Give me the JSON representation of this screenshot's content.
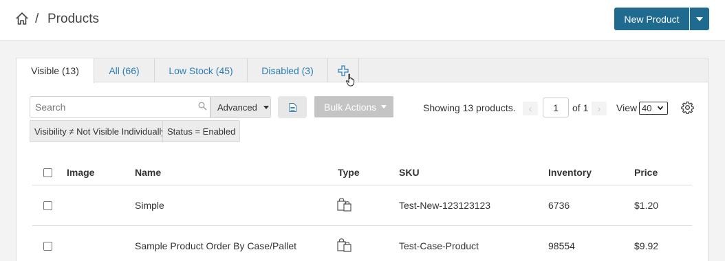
{
  "header": {
    "breadcrumb_sep": "/",
    "title": "Products",
    "new_button": "New Product",
    "home_icon": "home-icon",
    "caret_icon": "chevron-down-icon"
  },
  "tabs": [
    {
      "label": "Visible (13)",
      "active": true
    },
    {
      "label": "All (66)",
      "active": false
    },
    {
      "label": "Low Stock (45)",
      "active": false
    },
    {
      "label": "Disabled (3)",
      "active": false
    }
  ],
  "toolbar": {
    "search_placeholder": "Search",
    "search_value": "",
    "advanced_label": "Advanced",
    "bulk_actions_label": "Bulk Actions",
    "showing_text": "Showing 13 products.",
    "prev_symbol": "‹",
    "next_symbol": "›",
    "page_value": "1",
    "of_text": "of 1",
    "view_label": "View",
    "view_value": "40"
  },
  "filters": [
    "Visibility ≠ Not Visible Individually",
    "Status = Enabled"
  ],
  "table": {
    "columns": [
      "Image",
      "Name",
      "Type",
      "SKU",
      "Inventory",
      "Price"
    ],
    "rows": [
      {
        "name": "Simple",
        "type_icon": "shopping-bag-icon",
        "sku": "Test-New-123123123",
        "inventory": "6736",
        "price": "$1.20"
      },
      {
        "name": "Sample Product Order By Case/Pallet",
        "type_icon": "shopping-bag-icon",
        "sku": "Test-Case-Product",
        "inventory": "98554",
        "price": "$9.92"
      }
    ]
  },
  "colors": {
    "primary": "#1f6a8f",
    "link": "#2c7db1",
    "disabled_button": "#c4c4c4"
  }
}
